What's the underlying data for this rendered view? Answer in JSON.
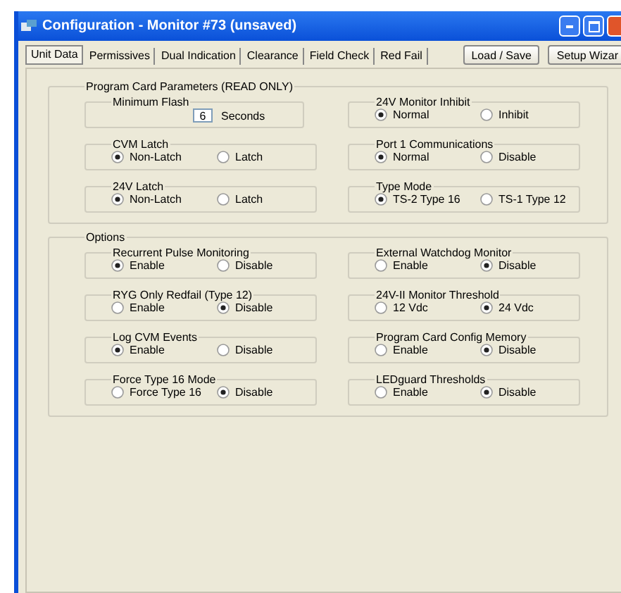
{
  "window": {
    "title": "Configuration - Monitor #73 (unsaved)"
  },
  "tabs": [
    {
      "label": "Unit Data",
      "selected": true
    },
    {
      "label": "Permissives",
      "selected": false
    },
    {
      "label": "Dual Indication",
      "selected": false
    },
    {
      "label": "Clearance",
      "selected": false
    },
    {
      "label": "Field Check",
      "selected": false
    },
    {
      "label": "Red Fail",
      "selected": false
    }
  ],
  "buttons": [
    "Load / Save",
    "Setup Wizar"
  ],
  "sections": [
    {
      "title": "Program Card Parameters (READ ONLY)",
      "columns": [
        [
          {
            "title": "Minimum Flash",
            "kind": "number",
            "value": "6",
            "unit": "Seconds"
          },
          {
            "title": "CVM Latch",
            "kind": "radio",
            "options": [
              {
                "label": "Non-Latch",
                "selected": true
              },
              {
                "label": "Latch",
                "selected": false
              }
            ]
          },
          {
            "title": "24V Latch",
            "kind": "radio",
            "options": [
              {
                "label": "Non-Latch",
                "selected": true
              },
              {
                "label": "Latch",
                "selected": false
              }
            ]
          }
        ],
        [
          {
            "title": "24V Monitor Inhibit",
            "kind": "radio",
            "options": [
              {
                "label": "Normal",
                "selected": true
              },
              {
                "label": "Inhibit",
                "selected": false
              }
            ]
          },
          {
            "title": "Port 1 Communications",
            "kind": "radio",
            "options": [
              {
                "label": "Normal",
                "selected": true
              },
              {
                "label": "Disable",
                "selected": false
              }
            ]
          },
          {
            "title": "Type Mode",
            "kind": "radio",
            "options": [
              {
                "label": "TS-2 Type 16",
                "selected": true
              },
              {
                "label": "TS-1 Type 12",
                "selected": false
              }
            ]
          }
        ]
      ]
    },
    {
      "title": "Options",
      "columns": [
        [
          {
            "title": "Recurrent Pulse Monitoring",
            "kind": "radio",
            "options": [
              {
                "label": "Enable",
                "selected": true
              },
              {
                "label": "Disable",
                "selected": false
              }
            ]
          },
          {
            "title": "RYG Only Redfail (Type 12)",
            "kind": "radio",
            "options": [
              {
                "label": "Enable",
                "selected": false
              },
              {
                "label": "Disable",
                "selected": true
              }
            ]
          },
          {
            "title": "Log CVM Events",
            "kind": "radio",
            "options": [
              {
                "label": "Enable",
                "selected": true
              },
              {
                "label": "Disable",
                "selected": false
              }
            ]
          },
          {
            "title": "Force Type 16 Mode",
            "kind": "radio",
            "options": [
              {
                "label": "Force Type 16",
                "selected": false
              },
              {
                "label": "Disable",
                "selected": true
              }
            ]
          }
        ],
        [
          {
            "title": "External Watchdog Monitor",
            "kind": "radio",
            "options": [
              {
                "label": "Enable",
                "selected": false
              },
              {
                "label": "Disable",
                "selected": true
              }
            ]
          },
          {
            "title": "24V-II Monitor Threshold",
            "kind": "radio",
            "options": [
              {
                "label": "12 Vdc",
                "selected": false
              },
              {
                "label": "24 Vdc",
                "selected": true
              }
            ]
          },
          {
            "title": "Program Card Config Memory",
            "kind": "radio",
            "options": [
              {
                "label": "Enable",
                "selected": false
              },
              {
                "label": "Disable",
                "selected": true
              }
            ]
          },
          {
            "title": "LEDguard Thresholds",
            "kind": "radio",
            "options": [
              {
                "label": "Enable",
                "selected": false
              },
              {
                "label": "Disable",
                "selected": true
              }
            ]
          }
        ]
      ]
    }
  ]
}
